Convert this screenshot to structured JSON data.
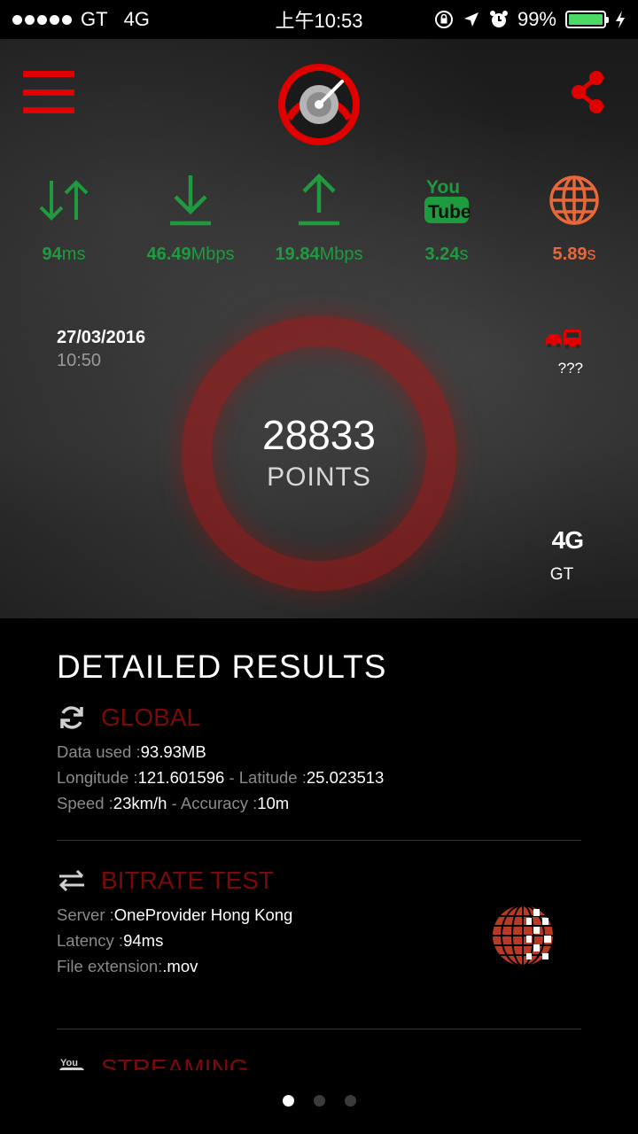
{
  "status_bar": {
    "carrier": "GT",
    "network": "4G",
    "time": "上午10:53",
    "battery": "99%"
  },
  "header": {
    "menu_icon": "hamburger-menu-icon",
    "logo_icon": "speedometer-icon",
    "share_icon": "share-icon"
  },
  "metrics": [
    {
      "icon": "latency-arrows-icon",
      "value": "94",
      "unit": "ms",
      "color": "#1f9a3e"
    },
    {
      "icon": "download-icon",
      "value": "46.49",
      "unit": "Mbps",
      "color": "#1f9a3e"
    },
    {
      "icon": "upload-icon",
      "value": "19.84",
      "unit": "Mbps",
      "color": "#1f9a3e"
    },
    {
      "icon": "youtube-icon",
      "value": "3.24",
      "unit": "s",
      "color": "#1f9a3e"
    },
    {
      "icon": "globe-icon",
      "value": "5.89",
      "unit": "s",
      "color": "#e8683a"
    }
  ],
  "test": {
    "date": "27/03/2016",
    "time": "10:50",
    "score": "28833",
    "score_label": "POINTS",
    "mobility": "???",
    "network_type": "4G",
    "operator": "GT"
  },
  "results": {
    "title": "DETAILED RESULTS",
    "global": {
      "title": "GLOBAL",
      "data_used_label": "Data used :",
      "data_used": "93.93MB",
      "longitude_label": "Longitude :",
      "longitude": "121.601596",
      "latitude_label": " - Latitude :",
      "latitude": "25.023513",
      "speed_label": "Speed :",
      "speed": "23km/h",
      "accuracy_label": " - Accuracy :",
      "accuracy": "10m"
    },
    "bitrate": {
      "title": "BITRATE TEST",
      "server_label": "Server :",
      "server": "OneProvider Hong Kong",
      "latency_label": "Latency :",
      "latency": "94ms",
      "file_ext_label": "File extension:",
      "file_ext": ".mov"
    },
    "streaming": {
      "title": "STREAMING"
    }
  },
  "pager": {
    "pages": 3,
    "active": 1
  },
  "colors": {
    "accent_red": "#e00000",
    "green": "#1f9a3e",
    "orange": "#e8683a",
    "dark_red": "#7a0a0a"
  }
}
